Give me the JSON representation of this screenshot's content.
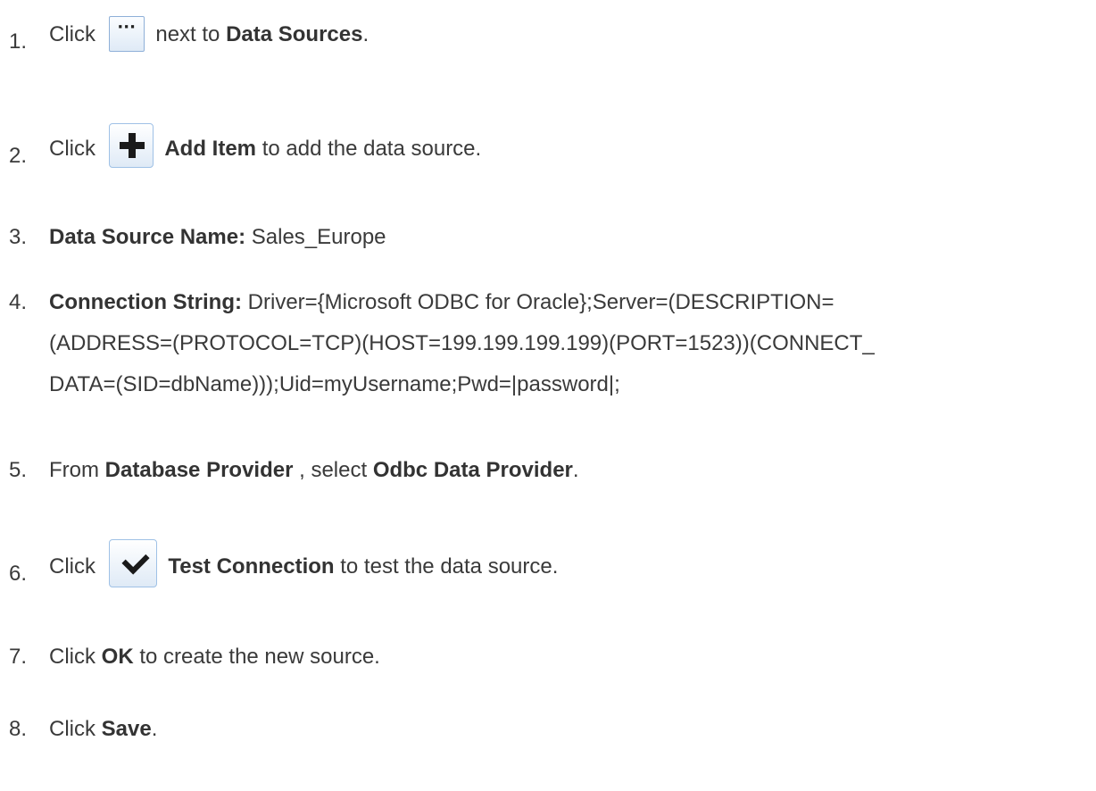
{
  "steps": [
    {
      "num": "1.",
      "pre": "Click",
      "icon_name": "ellipsis-icon",
      "icon_glyph": "···",
      "mid": "next to",
      "bold1": "Data Sources",
      "post": "."
    },
    {
      "num": "2.",
      "pre": "Click",
      "icon_name": "plus-icon",
      "bold1": "Add Item",
      "post": "to add the data source."
    },
    {
      "num": "3.",
      "bold1": "Data Source Name:",
      "post": "Sales_Europe"
    },
    {
      "num": "4.",
      "bold1": "Connection String:",
      "post": "Driver={Microsoft ODBC for Oracle};Server=(DESCRIPTION=(ADDRESS=(PROTOCOL=TCP)(HOST=199.199.199.199)(PORT=1523))(CONNECT_DATA=(SID=dbName)));Uid=myUsername;Pwd=|password|;",
      "line1": "Driver={Microsoft ODBC for Oracle};Server=(DESCRIPTION=",
      "line2": "(ADDRESS=(PROTOCOL=TCP)(HOST=199.199.199.199)(PORT=1523))(CONNECT_",
      "line3": "DATA=(SID=dbName)));Uid=myUsername;Pwd=|password|;"
    },
    {
      "num": "5.",
      "pre": "From",
      "bold1": "Database Provider",
      "mid": ", select",
      "bold2": "Odbc Data Provider",
      "post": "."
    },
    {
      "num": "6.",
      "pre": "Click",
      "icon_name": "checkmark-icon",
      "bold1": "Test Connection",
      "post": "to test the data source."
    },
    {
      "num": "7.",
      "pre": "Click",
      "bold1": "OK",
      "post": "to create the new source."
    },
    {
      "num": "8.",
      "pre": "Click",
      "bold1": "Save",
      "post": "."
    }
  ]
}
